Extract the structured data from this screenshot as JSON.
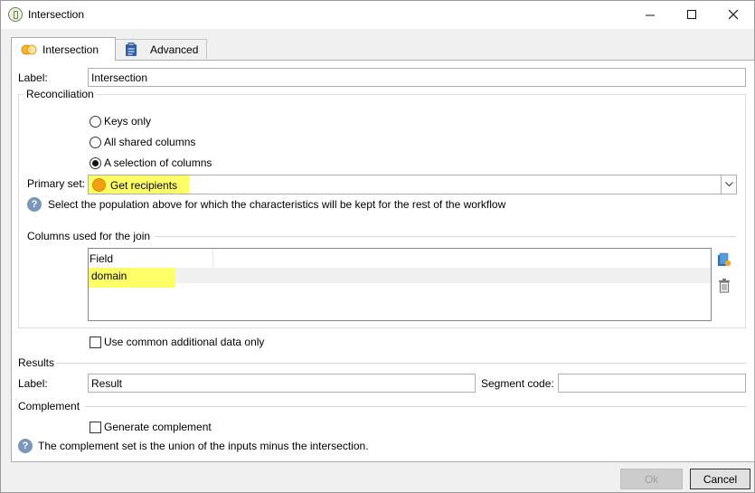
{
  "window": {
    "title": "Intersection"
  },
  "tabs": [
    {
      "label": "Intersection",
      "icon": "intersection-icon",
      "active": true
    },
    {
      "label": "Advanced",
      "icon": "clipboard-icon",
      "active": false
    }
  ],
  "label_field": {
    "label": "Label:",
    "value": "Intersection"
  },
  "reconciliation": {
    "title": "Reconciliation",
    "options": [
      "Keys only",
      "All shared columns",
      "A selection of columns"
    ],
    "selected_index": 2
  },
  "primary_set": {
    "label": "Primary set:",
    "value": "Get recipients",
    "help": "Select the population above for which the characteristics will be kept for the rest of the workflow",
    "icon_color": "#f0a010"
  },
  "join_columns": {
    "title": "Columns used for the join",
    "header": "Field",
    "rows": [
      "domain"
    ]
  },
  "use_common": {
    "label": "Use common additional data only",
    "checked": false
  },
  "results": {
    "title": "Results",
    "label": "Label:",
    "value": "Result",
    "segment_label": "Segment code:",
    "segment_value": ""
  },
  "complement": {
    "title": "Complement",
    "checkbox_label": "Generate complement",
    "checked": false,
    "help": "The complement set is the union of the inputs minus the intersection."
  },
  "buttons": {
    "ok": "Ok",
    "cancel": "Cancel"
  },
  "colors": {
    "highlight": "#ffff66",
    "help_icon": "#7a96b8"
  }
}
